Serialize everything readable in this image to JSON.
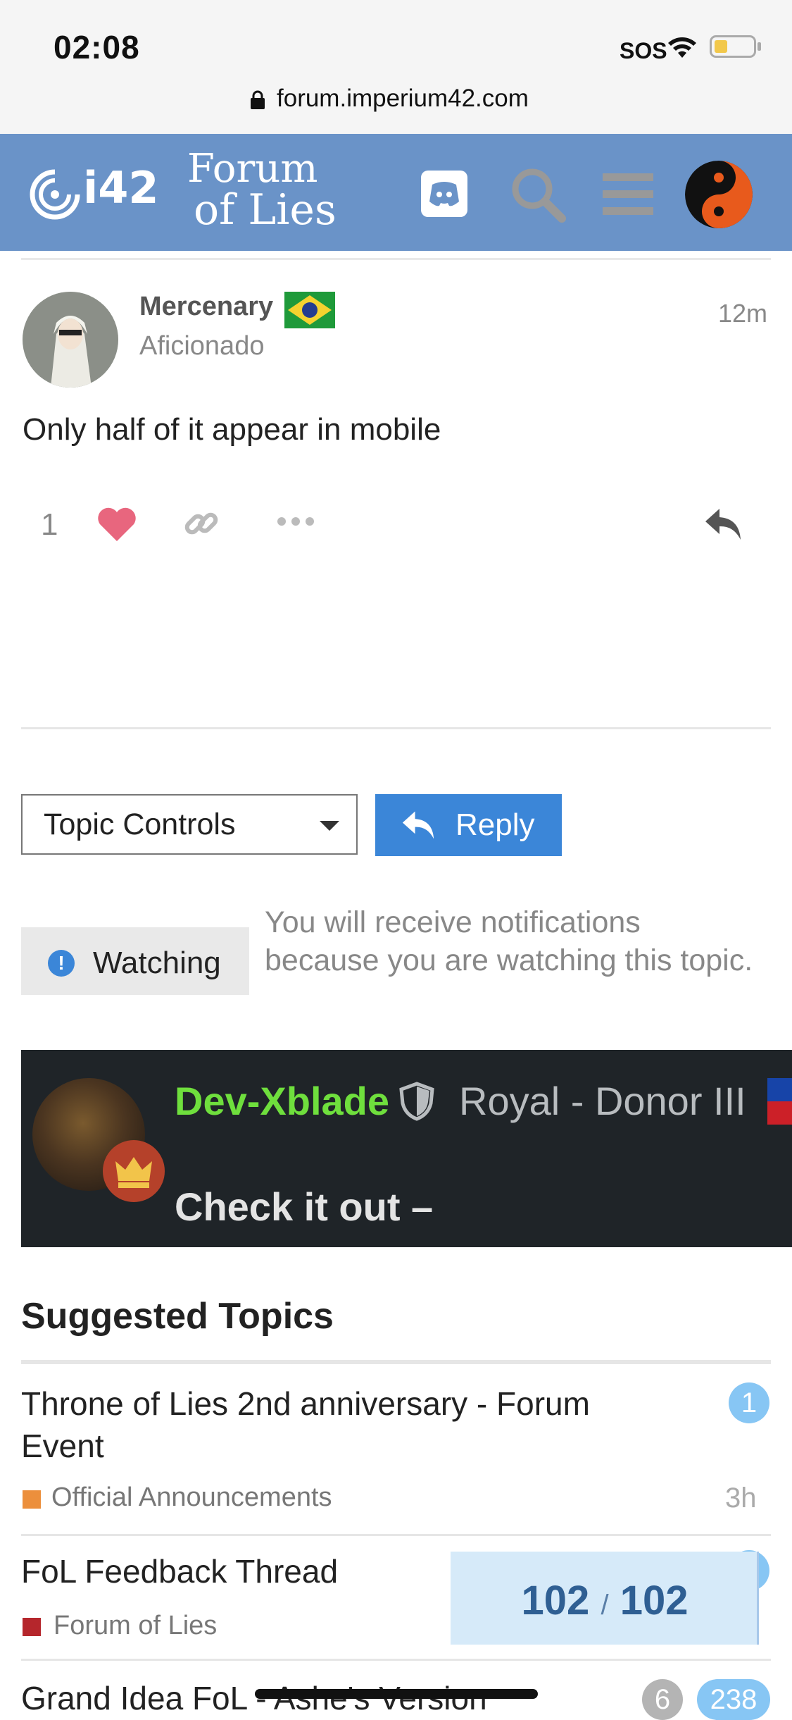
{
  "status_bar": {
    "time": "02:08",
    "carrier": "SOS",
    "icons": [
      "wifi-icon",
      "battery-icon"
    ]
  },
  "browser": {
    "url": "forum.imperium42.com",
    "icons": [
      "lock-icon"
    ]
  },
  "header": {
    "logo_i42": "i42",
    "logo_forum": "Forum",
    "logo_of_lies": "of Lies",
    "icons": [
      "discord-icon",
      "search-icon",
      "menu-icon",
      "yin-yang-avatar"
    ],
    "background": "#6a93c8"
  },
  "post": {
    "username": "Mercenary",
    "user_title": "Aficionado",
    "time_ago": "12m",
    "body": "Only half of it appear in mobile",
    "like_count": "1",
    "actions": [
      "like-icon",
      "link-icon",
      "more-icon",
      "reply-icon"
    ]
  },
  "controls": {
    "topic_controls_label": "Topic Controls",
    "reply_label": "Reply",
    "watching_label": "Watching",
    "watching_description": "You will receive notifications because you are watching this topic."
  },
  "signature": {
    "name": "Dev-Xblade",
    "rank": "Royal - Donor III",
    "cta": "Check it out –"
  },
  "suggested": {
    "heading": "Suggested Topics",
    "topics": [
      {
        "title": "Throne of Lies 2nd anniversary - Forum Event",
        "category": "Official Announcements",
        "category_color": "#ec8f3c",
        "badge": "1",
        "age": "3h"
      },
      {
        "title": "FoL Feedback Thread",
        "category": "Forum of Lies",
        "category_color": "#b5262c",
        "badge": ""
      },
      {
        "title": "Grand Idea FoL - Ashe's Version",
        "badges": [
          "6",
          "238"
        ]
      }
    ]
  },
  "progress": {
    "current": "102",
    "separator": "/",
    "total": "102"
  },
  "colors": {
    "accent": "#3b86d8",
    "like": "#e8667e",
    "badge_blue": "#87c6f4"
  }
}
